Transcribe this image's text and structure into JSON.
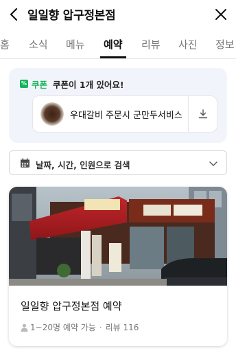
{
  "header": {
    "title": "일일향 압구정본점"
  },
  "tabs": [
    {
      "label": "홈",
      "active": false
    },
    {
      "label": "소식",
      "active": false
    },
    {
      "label": "메뉴",
      "active": false
    },
    {
      "label": "예약",
      "active": true
    },
    {
      "label": "리뷰",
      "active": false
    },
    {
      "label": "사진",
      "active": false
    },
    {
      "label": "정보",
      "active": false
    }
  ],
  "coupon": {
    "tag": "쿠폰",
    "count_text": "쿠폰이 1개 있어요!",
    "item_text": "우대갈비 주문시 군만두서비스",
    "accent_color": "#17b35a"
  },
  "search": {
    "label": "날짜, 시간, 인원으로 검색"
  },
  "store": {
    "name": "일일향 압구정본점 예약",
    "capacity": "1~20명 예약 가능",
    "review_label": "리뷰 116"
  }
}
